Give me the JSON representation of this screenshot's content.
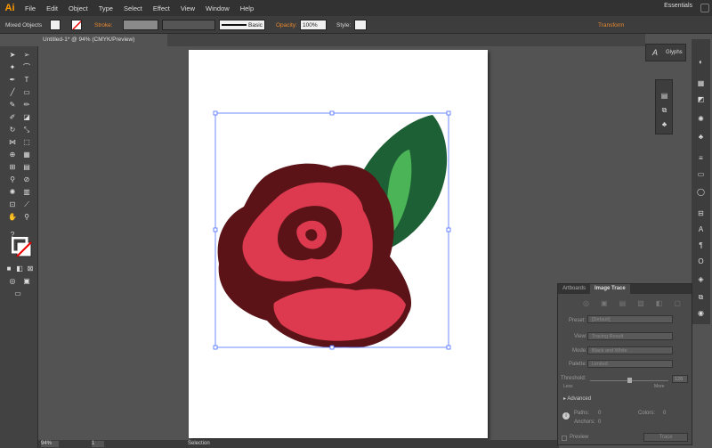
{
  "app": {
    "logo": "Ai",
    "menus": [
      "File",
      "Edit",
      "Object",
      "Type",
      "Select",
      "Effect",
      "View",
      "Window",
      "Help"
    ],
    "workspace": "Essentials"
  },
  "control_bar": {
    "selection_label": "Mixed Objects",
    "stroke_label": "Stroke:",
    "brush_label": "Basic",
    "opacity_label": "Opacity:",
    "opacity_value": "100%",
    "style_label": "Style:",
    "transform_label": "Transform"
  },
  "document": {
    "tab_title": "Untitled-1* @ 94% (CMYK/Preview)"
  },
  "status_bar": {
    "zoom": "94%",
    "page": "1",
    "tool": "Selection"
  },
  "glyphs_panel": {
    "title": "Glyphs"
  },
  "image_trace": {
    "tabs": [
      "Artboards",
      "Image Trace"
    ],
    "preset_label": "Preset:",
    "preset_value": "[Default]",
    "view_label": "View:",
    "view_value": "Tracing Result",
    "mode_label": "Mode:",
    "mode_value": "Black and White",
    "palette_label": "Palette:",
    "palette_value": "Limited",
    "threshold_label": "Threshold:",
    "threshold_value": "128",
    "less_label": "Less",
    "more_label": "More",
    "advanced_label": "Advanced",
    "paths_label": "Paths:",
    "paths_value": "0",
    "colors_label": "Colors:",
    "colors_value": "0",
    "anchors_label": "Anchors:",
    "anchors_value": "0",
    "preview_label": "Preview",
    "trace_button": "Trace"
  },
  "colors": {
    "rose_fill": "#dd3a50",
    "rose_outline": "#5b1318",
    "leaf_dark": "#1e6036",
    "leaf_light": "#4bb457",
    "selection": "#4a6cff"
  }
}
